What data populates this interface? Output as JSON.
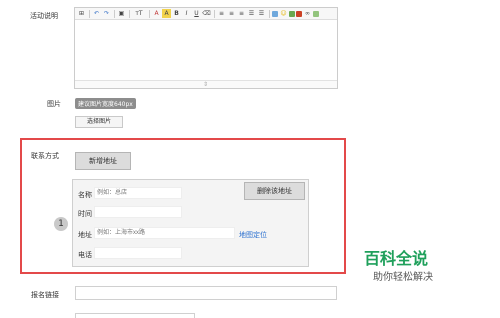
{
  "form": {
    "details_label": "活动说明",
    "image_label": "图片",
    "image_badge": "建议图片宽度640px",
    "choose_image_button": "选择图片",
    "contact_label": "联系方式",
    "add_address_button": "新增地址",
    "delete_address_button": "删除该地址",
    "address_index": "1",
    "name_label": "名称",
    "name_placeholder": "例如：总店",
    "time_label": "时间",
    "address_label": "地址",
    "address_placeholder": "例如：上海市xx路",
    "map_locate_link": "地图定位",
    "phone_label": "电话",
    "signup_link_label": "报名链接"
  },
  "editor": {
    "toolbar": [
      "source-icon",
      "undo-icon",
      "redo-icon",
      "image-icon",
      "font-size-icon",
      "font-color-icon",
      "highlight-icon",
      "bold-icon",
      "italic-icon",
      "underline-icon",
      "clear-format-icon",
      "align-left-icon",
      "align-center-icon",
      "align-right-icon",
      "ordered-list-icon",
      "unordered-list-icon",
      "table-icon",
      "emoji-icon",
      "map-icon",
      "video-icon",
      "link-icon",
      "picture-icon"
    ],
    "font_size_glyph": "тT",
    "font_color_glyph": "A",
    "bold_glyph": "B",
    "italic_glyph": "I",
    "underline_glyph": "U"
  },
  "watermark": {
    "title": "百科全说",
    "subtitle": "助你轻松解决"
  }
}
